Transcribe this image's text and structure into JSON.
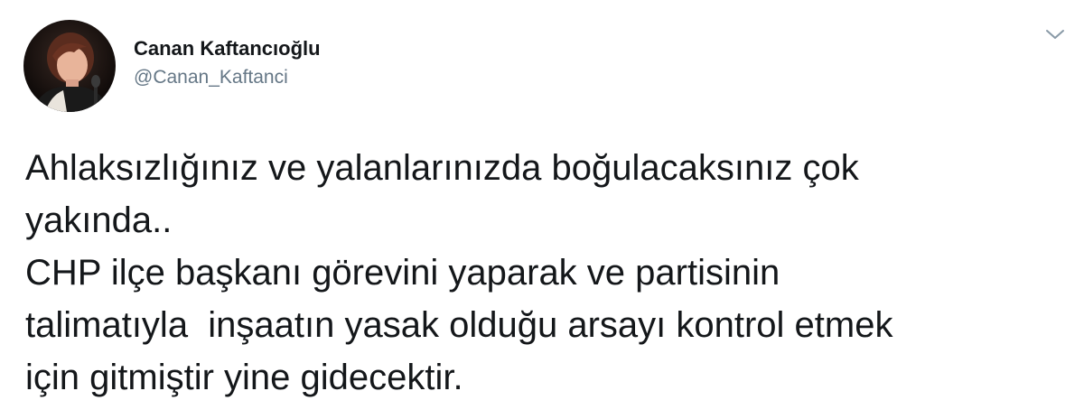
{
  "user": {
    "display_name": "Canan Kaftancıoğlu",
    "handle": "@Canan_Kaftanci"
  },
  "icons": {
    "avatar": "profile-photo",
    "menu": "chevron-down-icon"
  },
  "tweet": {
    "text": "Ahlaksızlığınız ve yalanlarınızda boğulacaksınız çok\nyakında..\nCHP ilçe başkanı görevini yaparak ve partisinin\ntalimatıyla  inşaatın yasak olduğu arsayı kontrol etmek\niçin gitmiştir yine gidecektir."
  },
  "colors": {
    "text": "#14171a",
    "secondary": "#657786",
    "background": "#ffffff"
  }
}
